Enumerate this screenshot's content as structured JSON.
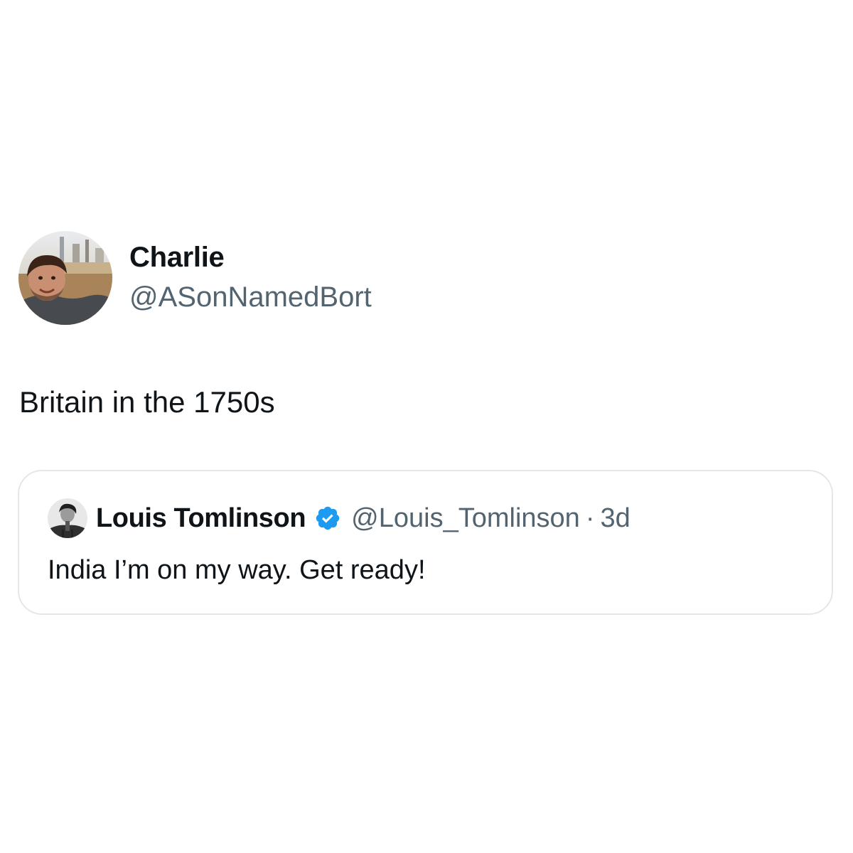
{
  "tweet": {
    "author": {
      "display_name": "Charlie",
      "handle": "@ASonNamedBort",
      "avatar": "profile-photo"
    },
    "text": "Britain in the 1750s",
    "quoted": {
      "author": {
        "display_name": "Louis Tomlinson",
        "handle": "@Louis_Tomlinson",
        "verified_icon": "verified-badge-icon",
        "avatar": "profile-photo"
      },
      "separator": "·",
      "time": "3d",
      "text": "India I’m on my way. Get ready!"
    }
  },
  "colors": {
    "text_primary": "#0f1419",
    "text_secondary": "#536471",
    "verified_blue": "#1d9bf0",
    "card_border": "#e3e7eb"
  }
}
